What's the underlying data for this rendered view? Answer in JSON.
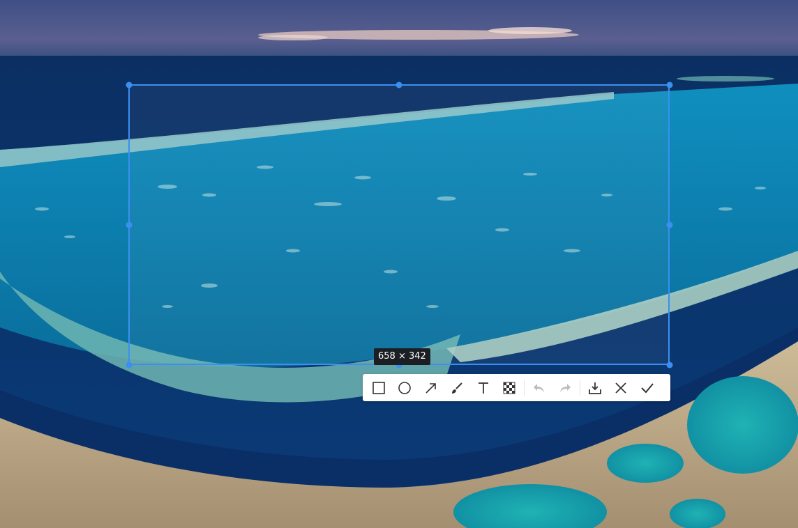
{
  "selection": {
    "size_label": "658 × 342"
  },
  "toolbar": {
    "items": [
      {
        "name": "rectangle-tool",
        "icon": "square-icon",
        "enabled": true
      },
      {
        "name": "ellipse-tool",
        "icon": "circle-icon",
        "enabled": true
      },
      {
        "name": "arrow-tool",
        "icon": "arrow-icon",
        "enabled": true
      },
      {
        "name": "brush-tool",
        "icon": "brush-icon",
        "enabled": true
      },
      {
        "name": "text-tool",
        "icon": "text-icon",
        "enabled": true
      },
      {
        "name": "mosaic-tool",
        "icon": "mosaic-icon",
        "enabled": true
      },
      {
        "name": "undo",
        "icon": "undo-icon",
        "enabled": false
      },
      {
        "name": "redo",
        "icon": "redo-icon",
        "enabled": false
      },
      {
        "name": "save",
        "icon": "download-icon",
        "enabled": true
      },
      {
        "name": "cancel",
        "icon": "close-icon",
        "enabled": true
      },
      {
        "name": "confirm",
        "icon": "check-icon",
        "enabled": true
      }
    ]
  },
  "colors": {
    "selection_border": "#3b8ff0",
    "icon_active": "#333333",
    "icon_disabled": "#bcbcbc",
    "label_bg": "#1b1f24"
  }
}
